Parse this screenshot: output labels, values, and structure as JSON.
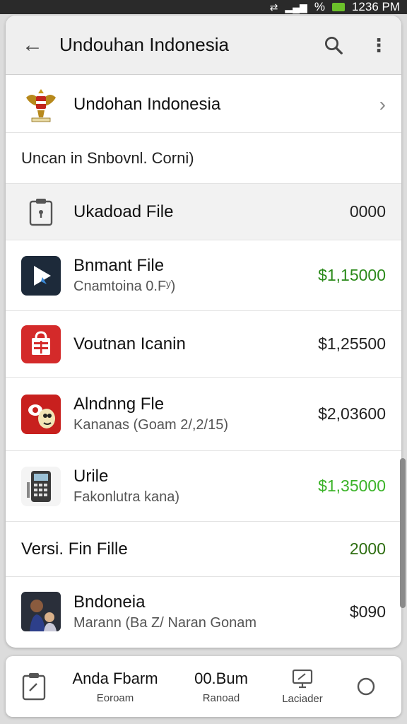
{
  "status": {
    "time": "1236 PM",
    "battery": "%"
  },
  "app_bar": {
    "title": "Undouhan Indonesia"
  },
  "header": {
    "title": "Undohan Indonesia"
  },
  "subtitle": "Uncan in Snbovnl. Corni)",
  "upload": {
    "label": "Ukadoad File",
    "amount": "0000"
  },
  "items": [
    {
      "title": "Bnmant File",
      "subtitle": "Cnamtoina 0.Fʸ)",
      "amount": "$1,15000",
      "color": "#2b8a1a"
    },
    {
      "title": "Voutnan Icanin",
      "subtitle": "",
      "amount": "$1,25500",
      "color": "#222222"
    },
    {
      "title": "Alndnng Fle",
      "subtitle": "Kananas (Goam 2/,2/15)",
      "amount": "$2,03600",
      "color": "#222222"
    },
    {
      "title": "Urile",
      "subtitle": "Fakonlutra kana)",
      "amount": "$1,35000",
      "color": "#3bb328"
    },
    {
      "title": "Versi. Fin Fille",
      "subtitle": "",
      "amount": "2000",
      "color": "#2d6d10"
    },
    {
      "title": "Bndoneia",
      "subtitle": "Marann (Ba Z/ Naran Gonam",
      "amount": "$090",
      "color": "#222222"
    }
  ],
  "bottom": {
    "col1": {
      "big": "Anda Fbarm",
      "small": "Eoroam"
    },
    "col2": {
      "big": "00.Bum",
      "small": "Ranoad"
    },
    "col3": {
      "small": "Laciader"
    }
  }
}
